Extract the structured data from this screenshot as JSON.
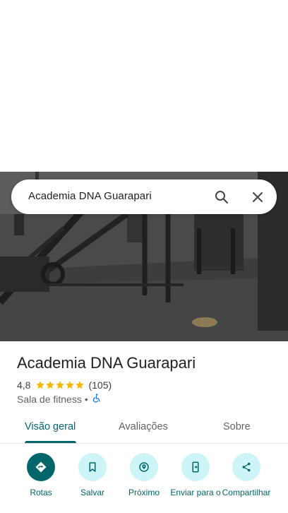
{
  "search": {
    "query": "Academia DNA Guarapari"
  },
  "place": {
    "name": "Academia DNA Guarapari",
    "rating": "4,8",
    "stars": 5,
    "review_count": "(105)",
    "category": "Sala de fitness",
    "separator": "•"
  },
  "tabs": [
    {
      "label": "Visão geral",
      "active": true
    },
    {
      "label": "Avaliações",
      "active": false
    },
    {
      "label": "Sobre",
      "active": false
    }
  ],
  "actions": [
    {
      "label": "Rotas"
    },
    {
      "label": "Salvar"
    },
    {
      "label": "Próximo"
    },
    {
      "label": "Enviar para o"
    },
    {
      "label": "Compartilhar"
    }
  ],
  "colors": {
    "accent": "#00666b",
    "accent_light": "#cdf4f7",
    "star": "#f9b702",
    "accessibility": "#1a73e8"
  },
  "icons": [
    "search-icon",
    "close-icon",
    "star-icon",
    "wheelchair-icon",
    "directions-icon",
    "bookmark-icon",
    "nearby-icon",
    "send-to-phone-icon",
    "share-icon"
  ]
}
